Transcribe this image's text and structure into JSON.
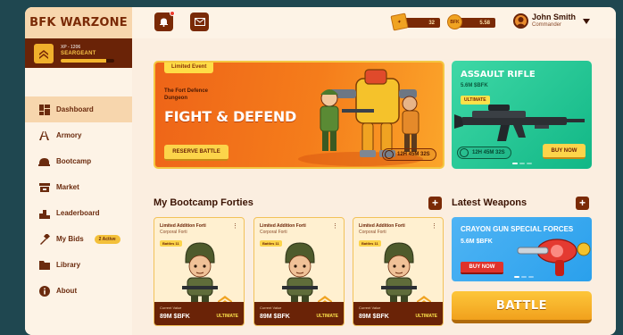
{
  "app": {
    "title": "BFK WARZONE"
  },
  "rank": {
    "xp": "XP - 1206",
    "name": "SEARGEANT",
    "progress": 0.85
  },
  "nav": [
    {
      "label": "Dashboard",
      "icon": "dashboard-icon",
      "active": true
    },
    {
      "label": "Armory",
      "icon": "armory-icon"
    },
    {
      "label": "Bootcamp",
      "icon": "bootcamp-icon"
    },
    {
      "label": "Market",
      "icon": "market-icon"
    },
    {
      "label": "Leaderboard",
      "icon": "leaderboard-icon"
    },
    {
      "label": "My Bids",
      "icon": "hammer-icon",
      "badge": "2 Active"
    },
    {
      "label": "Library",
      "icon": "folder-icon"
    },
    {
      "label": "About",
      "icon": "info-icon"
    }
  ],
  "topbar": {
    "currency1": "32",
    "currency2": "5.58",
    "user_name": "John Smith",
    "user_role": "Commander"
  },
  "banner": {
    "tag": "Limited Event",
    "subtitle": "The Fort Defence Dungeon",
    "title": "FIGHT & DEFEND",
    "button": "RESERVE BATTLE",
    "timer": "12H 45M 32S"
  },
  "featured": {
    "title": "ASSAULT RIFLE",
    "value": "5.6M $BFK",
    "tag": "ULTIMATE",
    "timer": "12H 45M 32S",
    "button": "BUY NOW"
  },
  "bootcamp": {
    "title": "My Bootcamp Forties",
    "cards": [
      {
        "name": "Limited Addition Forti",
        "rank": "Corporal Forti",
        "tag": "Battles 11",
        "value_label": "Current Value",
        "value": "89M $BFK",
        "tier": "ULTIMATE"
      },
      {
        "name": "Limited Addition Forti",
        "rank": "Corporal Forti",
        "tag": "Battles 11",
        "value_label": "Current Value",
        "value": "89M $BFK",
        "tier": "ULTIMATE"
      },
      {
        "name": "Limited Addition Forti",
        "rank": "Corporal Forti",
        "tag": "Battles 11",
        "value_label": "Current Value",
        "value": "89M $BFK",
        "tier": "ULTIMATE"
      }
    ]
  },
  "weapons": {
    "title": "Latest Weapons",
    "item": {
      "title": "CRAYON GUN SPECIAL FORCES",
      "value": "5.6M $BFK",
      "button": "BUY NOW"
    }
  },
  "battle_button": "BATTLE",
  "colors": {
    "brand": "#7a2a06",
    "accent": "#f3b52c",
    "green": "#11b786",
    "blue": "#2aa0ec"
  }
}
